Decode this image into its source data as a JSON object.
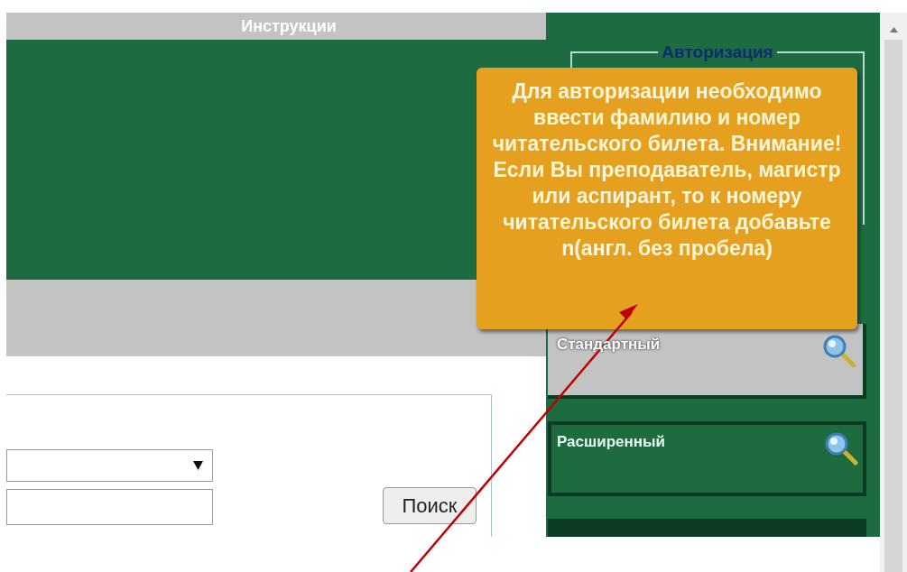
{
  "header": {
    "title": "Инструкции"
  },
  "search_form": {
    "search_button": "Поиск"
  },
  "auth": {
    "legend": "Авторизация",
    "tooltip": "Для авторизации необходимо ввести фамилию и номер читательского билета. Внимание! Если Вы преподаватель, магистр или аспирант, то к номеру читательского билета добавьте n(англ. без пробела)"
  },
  "search_modes": [
    {
      "label": "Стандартный",
      "selected": true
    },
    {
      "label": "Расширенный",
      "selected": false
    }
  ]
}
